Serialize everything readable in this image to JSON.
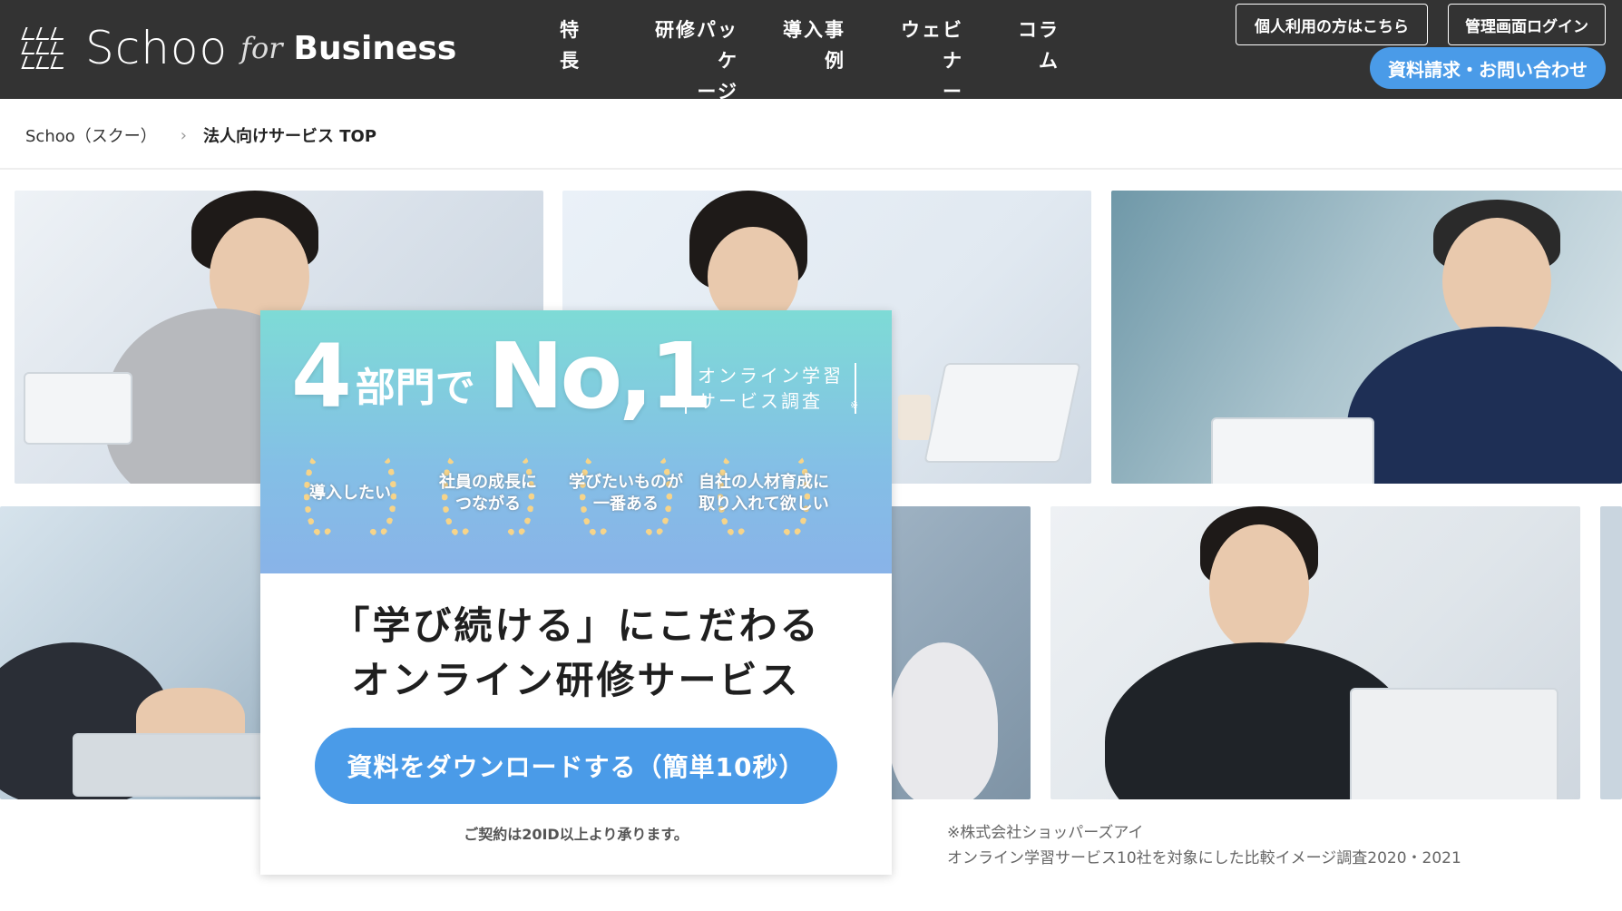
{
  "header": {
    "logo_text": "Schoo",
    "logo_for": "for",
    "logo_business": "Business",
    "nav": [
      {
        "line1": "特",
        "line2": "長"
      },
      {
        "line1": "研修パッケ",
        "line2": "ージ"
      },
      {
        "line1": "導入事",
        "line2": "例"
      },
      {
        "line1": "ウェビナ",
        "line2": "ー"
      },
      {
        "line1": "コラ",
        "line2": "ム"
      }
    ],
    "personal_button": "個人利用の方はこちら",
    "admin_button": "管理画面ログイン",
    "contact_button": "資料請求・お問い合わせ"
  },
  "breadcrumb": {
    "home": "Schoo（スクー）",
    "separator": "›",
    "current": "法人向けサービス TOP"
  },
  "hero": {
    "no1_num": "4",
    "no1_mid": "部門で",
    "no1_title": "No,1",
    "survey_line1": "オンライン学習",
    "survey_line2": "サービス調査",
    "survey_mark": "※",
    "awards": [
      {
        "line1": "導入したい",
        "line2": ""
      },
      {
        "line1": "社員の成長に",
        "line2": "つながる"
      },
      {
        "line1": "学びたいものが",
        "line2": "一番ある"
      },
      {
        "line1": "自社の人材育成に",
        "line2": "取り入れて欲しい"
      }
    ],
    "headline_line1": "「学び続ける」にこだわる",
    "headline_line2": "オンライン研修サービス",
    "download_button": "資料をダウンロードする（簡単10秒）",
    "contract_note": "ご契約は20ID以上より承ります。"
  },
  "footnote": {
    "line1": "※株式会社ショッパーズアイ",
    "line2": "オンライン学習サービス10社を対象にした比較イメージ調査2020・2021"
  },
  "colors": {
    "header_bg": "#333333",
    "accent_blue": "#4a9be8",
    "card_gradient_top": "#7edbd6",
    "card_gradient_bottom": "#89b3e8",
    "laurel_gold": "#f6d48a"
  }
}
